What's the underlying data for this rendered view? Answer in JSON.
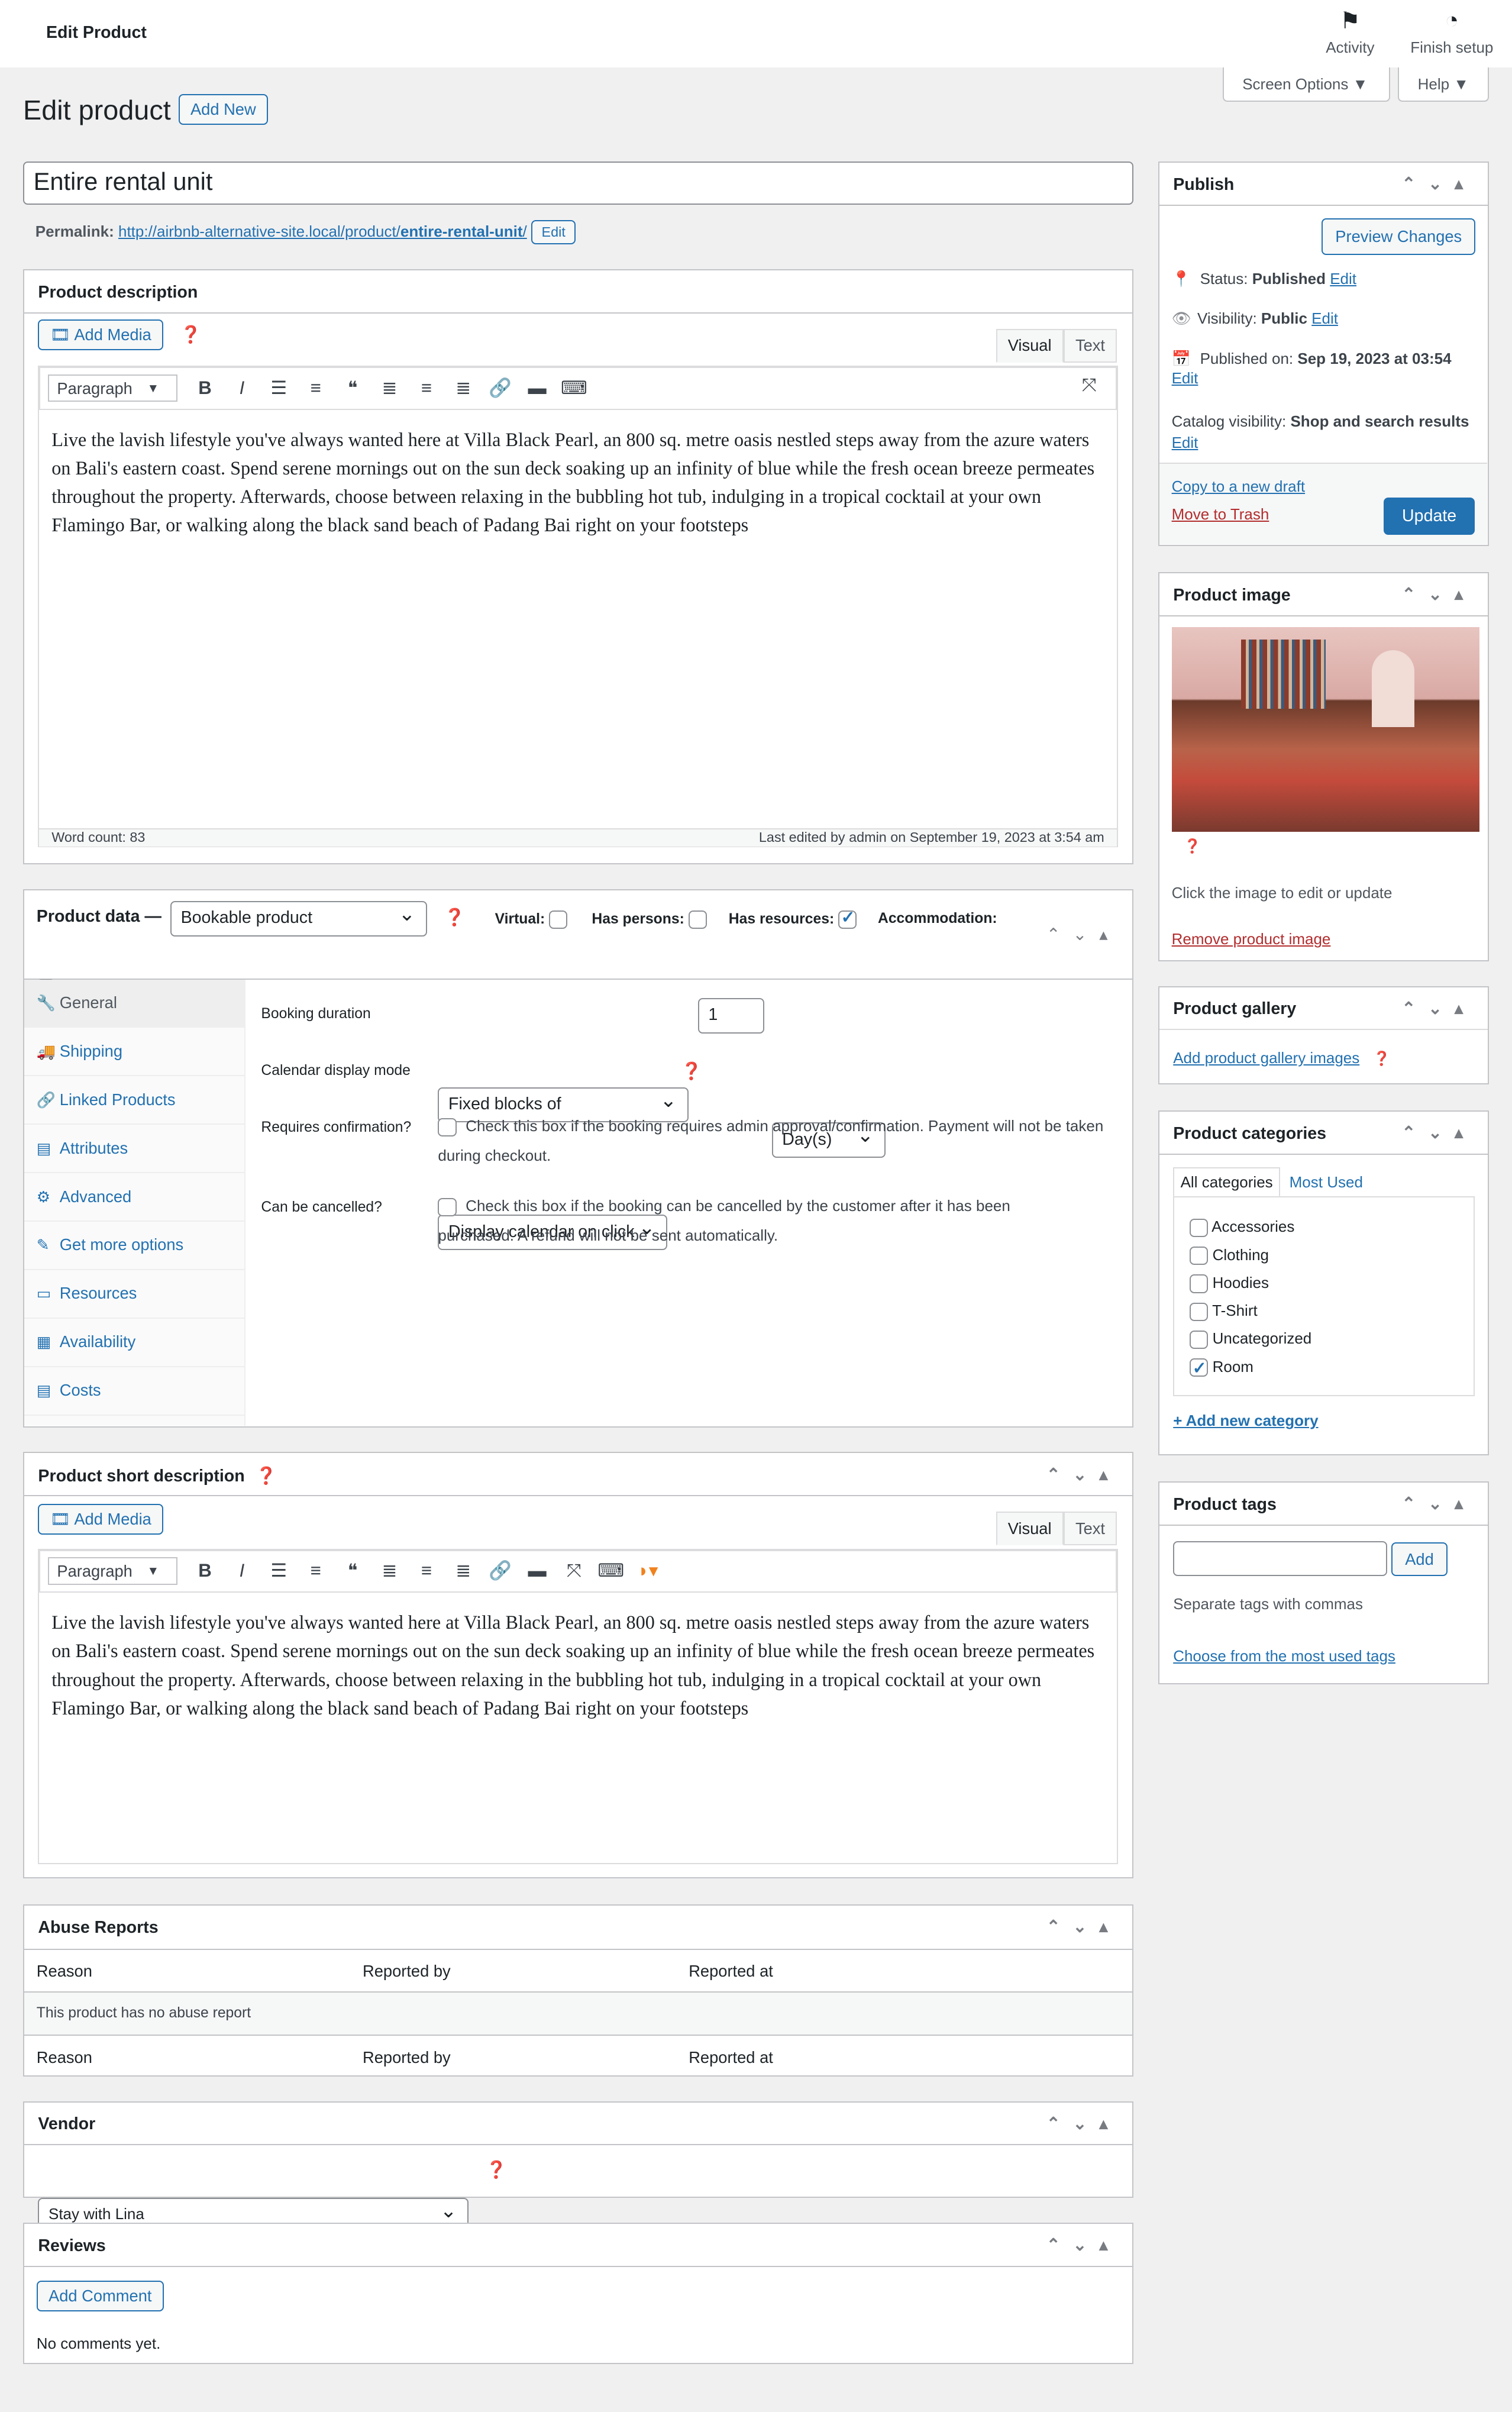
{
  "topbar": {
    "title": "Edit Product",
    "activity": "Activity",
    "finish_setup": "Finish setup",
    "activity_icon": "flag-icon",
    "finish_icon": "progress-circle-icon"
  },
  "screen_options": "Screen Options ▼",
  "help": "Help ▼",
  "heading": {
    "title": "Edit product",
    "add_new": "Add New"
  },
  "post_title": "Entire rental unit",
  "permalink": {
    "label": "Permalink:",
    "url_base": "http://airbnb-alternative-site.local/product/",
    "slug": "entire-rental-unit",
    "suffix": "/",
    "edit": "Edit"
  },
  "description": {
    "title": "Product description",
    "add_media": "Add Media",
    "tab_visual": "Visual",
    "tab_text": "Text",
    "format": "Paragraph",
    "content": "Live the lavish lifestyle you've always wanted here at Villa Black Pearl, an 800 sq. metre oasis nestled steps away from the azure waters on Bali's eastern coast. Spend serene mornings out on the sun deck soaking up an infinity of blue while the fresh ocean breeze permeates throughout the property. Afterwards, choose between relaxing in the bubbling hot tub, indulging in a tropical cocktail at your own Flamingo Bar, or walking along the black sand beach of Padang Bai right on your footsteps",
    "word_count": "Word count: 83",
    "last_edited": "Last edited by admin on September 19, 2023 at 3:54 am"
  },
  "product_data": {
    "label": "Product data —",
    "type": "Bookable product",
    "virtual": "Virtual:",
    "has_persons": "Has persons:",
    "has_resources": "Has resources:",
    "accommodation": "Accommodation:",
    "virtual_checked": false,
    "has_persons_checked": false,
    "has_resources_checked": true,
    "accommodation_checked": false,
    "tabs": [
      {
        "label": "General",
        "icon": "wrench-icon"
      },
      {
        "label": "Shipping",
        "icon": "truck-icon"
      },
      {
        "label": "Linked Products",
        "icon": "link-icon"
      },
      {
        "label": "Attributes",
        "icon": "list-icon"
      },
      {
        "label": "Advanced",
        "icon": "gear-icon"
      },
      {
        "label": "Get more options",
        "icon": "plugin-icon"
      },
      {
        "label": "Resources",
        "icon": "resource-icon"
      },
      {
        "label": "Availability",
        "icon": "calendar-icon"
      },
      {
        "label": "Costs",
        "icon": "costs-icon"
      }
    ],
    "booking_duration_label": "Booking duration",
    "duration_type": "Fixed blocks of",
    "duration_value": "1",
    "duration_unit": "Day(s)",
    "calendar_label": "Calendar display mode",
    "calendar_value": "Display calendar on click",
    "confirm_label": "Requires confirmation?",
    "confirm_text": "Check this box if the booking requires admin approval/confirmation. Payment will not be taken during checkout.",
    "cancel_label": "Can be cancelled?",
    "cancel_text": "Check this box if the booking can be cancelled by the customer after it has been purchased. A refund will not be sent automatically."
  },
  "short_description": {
    "title": "Product short description",
    "add_media": "Add Media",
    "tab_visual": "Visual",
    "tab_text": "Text",
    "format": "Paragraph",
    "content": "Live the lavish lifestyle you've always wanted here at Villa Black Pearl, an 800 sq. metre oasis nestled steps away from the azure waters on Bali's eastern coast. Spend serene mornings out on the sun deck soaking up an infinity of blue while the fresh ocean breeze permeates throughout the property. Afterwards, choose between relaxing in the bubbling hot tub, indulging in a tropical cocktail at your own Flamingo Bar, or walking along the black sand beach of Padang Bai right on your footsteps"
  },
  "abuse": {
    "title": "Abuse Reports",
    "cols": [
      "Reason",
      "Reported by",
      "Reported at"
    ],
    "empty": "This product has no abuse report"
  },
  "vendor": {
    "title": "Vendor",
    "value": "Stay with Lina"
  },
  "reviews": {
    "title": "Reviews",
    "add_comment": "Add Comment",
    "empty": "No comments yet."
  },
  "publish": {
    "title": "Publish",
    "preview": "Preview Changes",
    "status_label": "Status:",
    "status": "Published",
    "visibility_label": "Visibility:",
    "visibility": "Public",
    "published_label": "Published on:",
    "published": "Sep 19, 2023 at 03:54",
    "catalog_label": "Catalog visibility:",
    "catalog": "Shop and search results",
    "edit": "Edit",
    "copy": "Copy to a new draft",
    "trash": "Move to Trash",
    "update": "Update"
  },
  "product_image": {
    "title": "Product image",
    "hint": "Click the image to edit or update",
    "remove": "Remove product image"
  },
  "gallery": {
    "title": "Product gallery",
    "add": "Add product gallery images"
  },
  "categories": {
    "title": "Product categories",
    "tab_all": "All categories",
    "tab_most": "Most Used",
    "items": [
      {
        "label": "Accessories",
        "checked": false
      },
      {
        "label": "Clothing",
        "checked": false
      },
      {
        "label": "Hoodies",
        "checked": false
      },
      {
        "label": "T-Shirt",
        "checked": false
      },
      {
        "label": "Uncategorized",
        "checked": false
      },
      {
        "label": "Room",
        "checked": true
      }
    ],
    "add": "+ Add new category"
  },
  "tags": {
    "title": "Product tags",
    "add": "Add",
    "hint": "Separate tags with commas",
    "choose": "Choose from the most used tags"
  },
  "colors": {
    "accent": "#2271b1",
    "danger": "#b32d2e",
    "background": "#f0f0f1"
  }
}
